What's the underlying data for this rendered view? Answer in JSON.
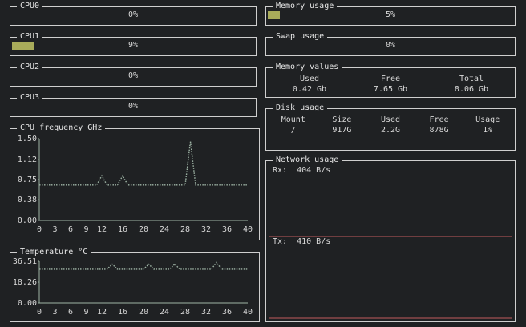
{
  "cpus": [
    {
      "name": "CPU0",
      "label": "0%",
      "value": 0
    },
    {
      "name": "CPU1",
      "label": "9%",
      "value": 9
    },
    {
      "name": "CPU2",
      "label": "0%",
      "value": 0
    },
    {
      "name": "CPU3",
      "label": "0%",
      "value": 0
    }
  ],
  "memory": {
    "title": "Memory usage",
    "label": "5%",
    "value": 5
  },
  "swap": {
    "title": "Swap usage",
    "label": "0%",
    "value": 0
  },
  "memory_values": {
    "title": "Memory values",
    "headers": [
      "Used",
      "Free",
      "Total"
    ],
    "values": [
      "0.42 Gb",
      "7.65 Gb",
      "8.06 Gb"
    ]
  },
  "disk": {
    "title": "Disk usage",
    "headers": [
      "Mount",
      "Size",
      "Used",
      "Free",
      "Usage"
    ],
    "values": [
      "/",
      "917G",
      "2.2G",
      "878G",
      "1%"
    ]
  },
  "network": {
    "title": "Network usage",
    "rx_label": "Rx:  404 B/s",
    "tx_label": "Tx:  410 B/s"
  },
  "colors": {
    "gauge": "#a8ab5a",
    "line": "#9fb5a6",
    "bar": "#c25a5d",
    "border": "#cfcfcf"
  },
  "chart_data": [
    {
      "type": "line",
      "title": "CPU frequency GHz",
      "x": [
        0,
        1,
        2,
        3,
        4,
        5,
        6,
        7,
        8,
        9,
        10,
        11,
        12,
        13,
        14,
        15,
        16,
        17,
        18,
        19,
        20,
        21,
        22,
        23,
        24,
        25,
        26,
        27,
        28,
        29,
        30,
        31,
        32,
        33,
        34,
        35,
        36,
        37,
        38,
        39,
        40
      ],
      "y": [
        0.65,
        0.65,
        0.65,
        0.65,
        0.65,
        0.65,
        0.65,
        0.65,
        0.65,
        0.65,
        0.65,
        0.65,
        0.82,
        0.65,
        0.65,
        0.65,
        0.82,
        0.65,
        0.65,
        0.65,
        0.65,
        0.65,
        0.65,
        0.65,
        0.65,
        0.65,
        0.65,
        0.65,
        0.65,
        1.45,
        0.65,
        0.65,
        0.65,
        0.65,
        0.65,
        0.65,
        0.65,
        0.65,
        0.65,
        0.65,
        0.65
      ],
      "ylim": [
        0,
        1.5
      ],
      "yticks": [
        "0.00",
        "0.38",
        "0.75",
        "1.12",
        "1.50"
      ],
      "xticks": [
        "0",
        "3",
        "6",
        "9",
        "12",
        "16",
        "20",
        "24",
        "28",
        "32",
        "36",
        "40"
      ]
    },
    {
      "type": "line",
      "title": "Temperature °C",
      "x": [
        0,
        1,
        2,
        3,
        4,
        5,
        6,
        7,
        8,
        9,
        10,
        11,
        12,
        13,
        14,
        15,
        16,
        17,
        18,
        19,
        20,
        21,
        22,
        23,
        24,
        25,
        26,
        27,
        28,
        29,
        30,
        31,
        32,
        33,
        34,
        35,
        36,
        37,
        38,
        39,
        40
      ],
      "y": [
        29.5,
        29.5,
        29.5,
        29.5,
        29.5,
        29.5,
        29.5,
        29.5,
        29.5,
        29.5,
        29.5,
        29.5,
        29.5,
        29.5,
        34.0,
        29.5,
        29.5,
        29.5,
        29.5,
        29.5,
        29.5,
        34.0,
        29.5,
        29.5,
        29.5,
        29.5,
        34.0,
        29.5,
        29.5,
        29.5,
        29.5,
        29.5,
        29.5,
        29.5,
        35.5,
        29.5,
        29.5,
        29.5,
        29.5,
        29.5,
        29.5
      ],
      "ylim": [
        0,
        36.51
      ],
      "yticks": [
        "0.00",
        "18.26",
        "36.51"
      ],
      "xticks": [
        "0",
        "3",
        "6",
        "9",
        "12",
        "16",
        "20",
        "24",
        "28",
        "32",
        "36",
        "40"
      ]
    },
    {
      "type": "bar",
      "series": [
        {
          "values": [
            0,
            0,
            0,
            0,
            0,
            0,
            0,
            0,
            0,
            0,
            0,
            0,
            0,
            0,
            0,
            0,
            0,
            0,
            0,
            0,
            0,
            0,
            0,
            0,
            0,
            0,
            0,
            0,
            0,
            0,
            0,
            0,
            0,
            0,
            0,
            0,
            0,
            0,
            0,
            0,
            0,
            0,
            0,
            0,
            0,
            0,
            0,
            0,
            0,
            0,
            0,
            0,
            0,
            0,
            0,
            0,
            0,
            0,
            0,
            0,
            0,
            0,
            0,
            0,
            0,
            0,
            0,
            0,
            0,
            0,
            0,
            0,
            0,
            0,
            0,
            0,
            0,
            0,
            0,
            0,
            0,
            0,
            0,
            0,
            0,
            0,
            0,
            0,
            0,
            0,
            0,
            0,
            0,
            0,
            0,
            0,
            0,
            0,
            0,
            0
          ]
        },
        {
          "values": [
            0,
            0,
            0,
            0,
            0,
            0,
            0,
            0,
            0,
            0,
            0,
            0,
            0,
            0,
            0,
            0,
            0,
            0,
            0,
            0,
            0,
            0,
            0,
            0,
            0,
            0,
            0,
            0,
            0,
            0,
            0,
            0,
            0,
            0,
            0,
            0,
            0,
            0,
            0,
            0,
            0,
            0,
            0,
            0,
            0,
            0,
            0,
            0,
            0,
            0,
            0,
            0,
            0,
            0,
            0,
            0,
            0,
            0,
            0,
            0,
            0,
            0,
            0,
            0,
            0,
            0,
            0,
            0,
            0,
            0,
            0,
            0,
            0,
            0,
            0,
            0,
            0,
            0,
            0,
            0,
            0,
            0,
            0,
            0,
            0,
            0,
            0,
            0,
            0,
            0,
            0,
            0,
            0,
            0,
            0,
            0,
            0,
            0,
            0,
            0
          ]
        }
      ]
    }
  ]
}
